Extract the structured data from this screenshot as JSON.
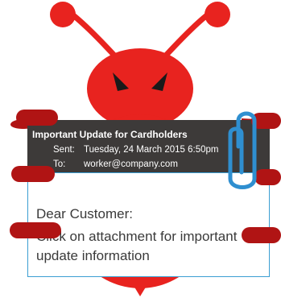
{
  "email": {
    "subject": "Important Update for Cardholders",
    "sent_label": "Sent:",
    "sent_value": "Tuesday, 24 March 2015 6:50pm",
    "to_label": "To:",
    "to_value": "worker@company.com",
    "greeting": "Dear Customer:",
    "body_line1": "Click on attachment for important",
    "body_line2": "update information"
  },
  "colors": {
    "bug_red": "#e8231f",
    "dark_red": "#b01414",
    "header_bg": "#3d3a39",
    "clip_blue": "#2f8fd0",
    "border_blue": "#3b9ed2"
  },
  "icons": [
    "bug-mascot",
    "paperclip-icon"
  ]
}
